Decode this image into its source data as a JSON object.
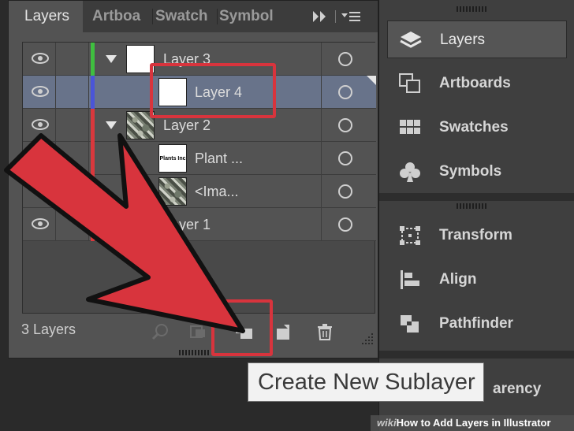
{
  "panel": {
    "tabs": [
      "Layers",
      "Artboa",
      "Swatch",
      "Symbol"
    ],
    "menu_glyphs": "▸▸ | ▾≡",
    "layers": [
      {
        "name": "Layer 3",
        "visible": true,
        "color": "#3fbf3f",
        "expandable": true,
        "thumb": "white",
        "selected": false
      },
      {
        "name": "Layer 4",
        "visible": true,
        "color": "#4a55d8",
        "expandable": false,
        "thumb": "white",
        "selected": true
      },
      {
        "name": "Layer 2",
        "visible": true,
        "color": "#d9383d",
        "expandable": true,
        "thumb": "photo",
        "selected": false
      },
      {
        "name": "Plant ...",
        "visible": false,
        "color": "#d9383d",
        "expandable": false,
        "thumb": "text",
        "selected": false
      },
      {
        "name": "<Ima...",
        "visible": false,
        "color": "#d9383d",
        "expandable": false,
        "thumb": "photo",
        "selected": false
      },
      {
        "name": "Layer 1",
        "visible": true,
        "color": "#d9383d",
        "expandable": false,
        "thumb": "white",
        "selected": false
      }
    ],
    "layer_count": "3 Layers",
    "thumb_text": "Plants Inc"
  },
  "dock": {
    "group1": [
      "Layers",
      "Artboards",
      "Swatches",
      "Symbols"
    ],
    "group2": [
      "Transform",
      "Align",
      "Pathfinder"
    ],
    "group3_label": "arency"
  },
  "tooltip": "Create New Sublayer",
  "watermark": {
    "brand": "wiki",
    "title": "How to Add Layers in Illustrator"
  },
  "colors": {
    "accent_red": "#d8343d",
    "selection": "#68738a"
  }
}
